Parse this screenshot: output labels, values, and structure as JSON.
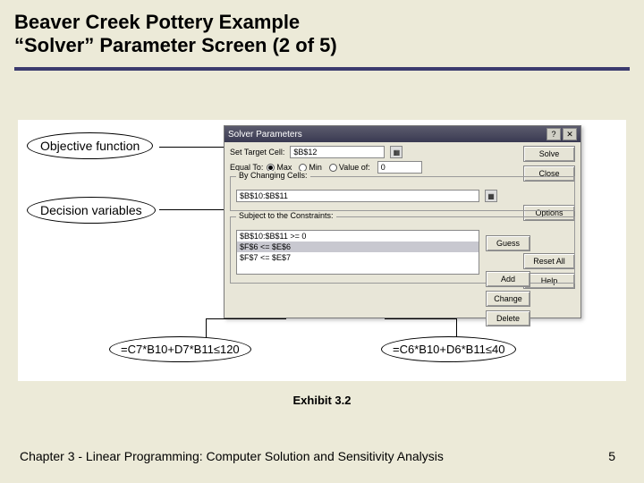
{
  "title_line1": "Beaver Creek Pottery Example",
  "title_line2": "“Solver” Parameter Screen (2 of 5)",
  "callouts": {
    "objective": "Objective function",
    "decision": "Decision variables"
  },
  "dialog": {
    "title": "Solver Parameters",
    "set_target_label": "Set Target Cell:",
    "target_value": "$B$12",
    "equal_to_label": "Equal To:",
    "opt_max": "Max",
    "opt_min": "Min",
    "opt_value": "Value of:",
    "value_of_value": "0",
    "changing_label": "By Changing Cells:",
    "changing_value": "$B$10:$B$11",
    "constraints_label": "Subject to the Constraints:",
    "constraints": [
      "$B$10:$B$11 >= 0",
      "$F$6 <= $E$6",
      "$F$7 <= $E$7"
    ],
    "btn_solve": "Solve",
    "btn_close": "Close",
    "btn_options": "Options",
    "btn_resetall": "Reset All",
    "btn_help": "Help",
    "btn_guess": "Guess",
    "btn_add": "Add",
    "btn_change": "Change",
    "btn_delete": "Delete"
  },
  "formulas": {
    "f1": "=C7*B10+D7*B11≤120",
    "f2": "=C6*B10+D6*B11≤40"
  },
  "caption": "Exhibit 3.2",
  "footer_left": "Chapter 3 - Linear Programming: Computer Solution and Sensitivity Analysis",
  "footer_page": "5"
}
